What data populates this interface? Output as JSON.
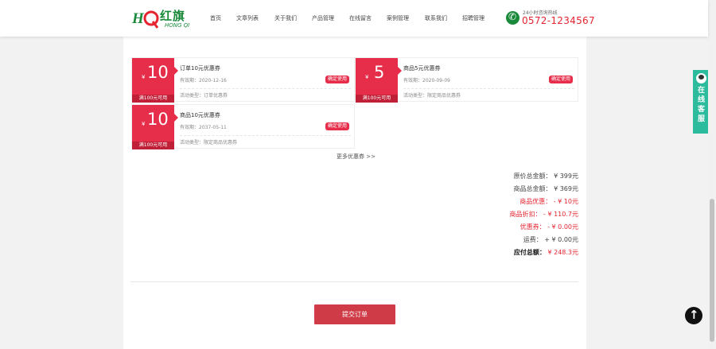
{
  "logo": {
    "mark": "HQ",
    "cn": "红旗",
    "en": "HONG QI"
  },
  "nav": [
    "首页",
    "文章列表",
    "关于我们",
    "产品管理",
    "在线留言",
    "案例管理",
    "联系我们",
    "招聘管理"
  ],
  "phone": {
    "tip": "24小时咨询热线",
    "number": "0572-1234567"
  },
  "coupons": [
    {
      "currency": "¥",
      "amount": "10",
      "condition": "满100元可用",
      "name": "订单10元优惠券",
      "valid": "有效期：2020-12-16",
      "type": "活动类型：订单优惠券",
      "button": "确定使用"
    },
    {
      "currency": "¥",
      "amount": "5",
      "condition": "满100元可用",
      "name": "商品5元优惠券",
      "valid": "有效期：2020-09-09",
      "type": "活动类型：限定商品优惠券",
      "button": "确定使用"
    },
    {
      "currency": "¥",
      "amount": "10",
      "condition": "满100元可用",
      "name": "商品10元优惠券",
      "valid": "有效期：2037-05-11",
      "type": "活动类型：限定商品优惠券",
      "button": "确定使用"
    }
  ],
  "more_coupons": "更多优惠券 >>",
  "summary": {
    "original_total": "原价总金额： ¥ 399元",
    "goods_total": "商品总金额： ¥ 369元",
    "goods_discount": "商品优惠： - ¥ 10元",
    "goods_rebate": "商品折扣： - ¥ 110.7元",
    "coupon": "优惠券： - ¥ 0.00元",
    "shipping": "运费： + ¥ 0.00元",
    "payable_label": "应付总额：",
    "payable_value": " ¥ 248.3元"
  },
  "submit_label": "提交订单",
  "service_text": "在线客服",
  "colors": {
    "accent": "#e62e4a",
    "brand_green": "#1a8a3a",
    "service": "#2dbb9d"
  }
}
